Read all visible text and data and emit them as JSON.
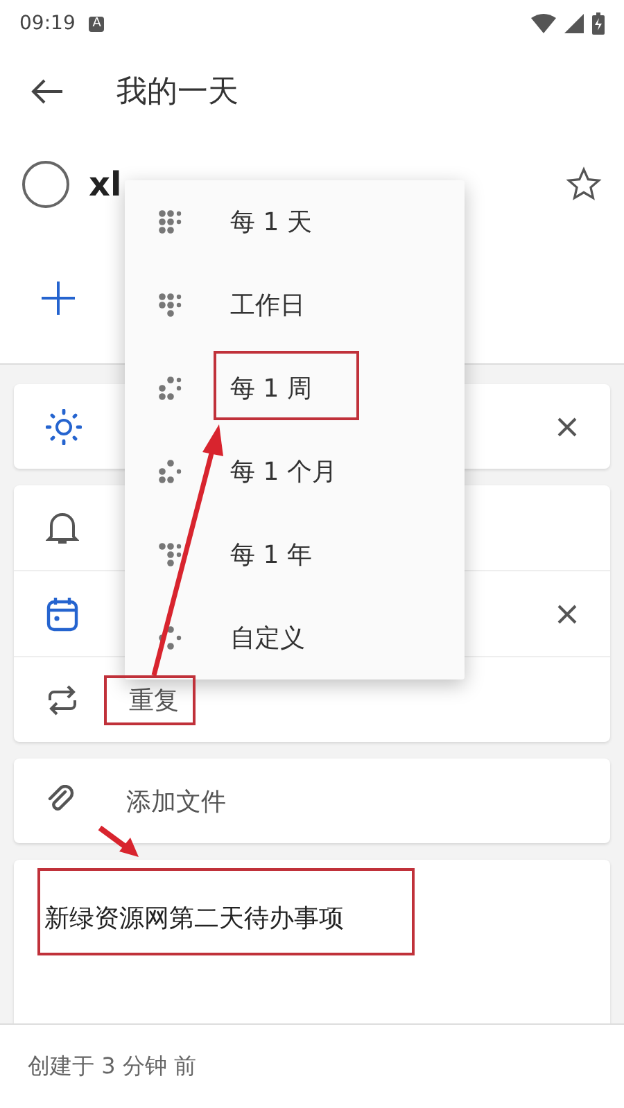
{
  "status_bar": {
    "time": "09:19",
    "notification": "A"
  },
  "header": {
    "title": "我的一天"
  },
  "task": {
    "title": "xl",
    "completed": false,
    "important": false
  },
  "menu": {
    "items": [
      {
        "label": "每 1 天",
        "selected": false
      },
      {
        "label": "工作日",
        "selected": false
      },
      {
        "label": "每 1 周",
        "selected": false
      },
      {
        "label": "每 1 个月",
        "selected": false
      },
      {
        "label": "每 1 年",
        "selected": false
      },
      {
        "label": "自定义",
        "selected": false
      }
    ]
  },
  "repeat_label": "重复",
  "attach_label": "添加文件",
  "note": "新绿资源网第二天待办事项",
  "footer": "创建于 3 分钟 前"
}
